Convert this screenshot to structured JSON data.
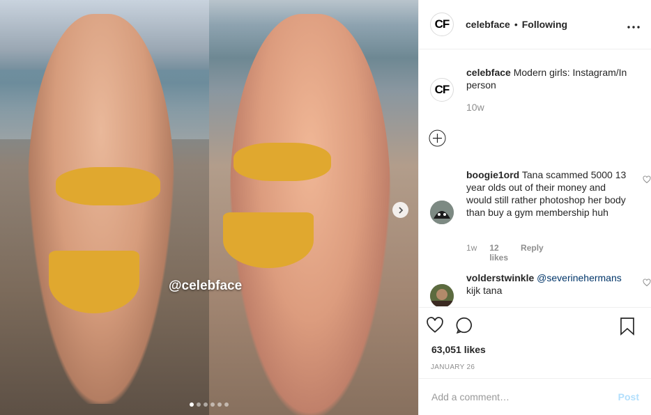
{
  "post": {
    "watermark": "@celebface",
    "slide_count": 6,
    "active_slide": 1
  },
  "header": {
    "avatar_text": "CF",
    "username": "celebface",
    "separator": "•",
    "follow_status": "Following",
    "more_icon": "more-dots-icon"
  },
  "caption": {
    "avatar_text": "CF",
    "username": "celebface",
    "text": "Modern girls: Instagram/In person",
    "time": "10w"
  },
  "comments": [
    {
      "username": "boogie1ord",
      "text": "Tana scammed 5000 13 year olds out of their money and would still rather photoshop her body than buy a gym membership huh",
      "time": "1w",
      "likes": "12 likes",
      "reply": "Reply"
    },
    {
      "username": "volderstwinkle",
      "mention": "@severinehermans",
      "text": "kijk tana"
    }
  ],
  "actions": {
    "likes": "63,051 likes",
    "date": "JANUARY 26"
  },
  "add_comment": {
    "placeholder": "Add a comment…",
    "post_label": "Post"
  },
  "colors": {
    "link_blue": "#003569",
    "post_disabled": "#b2dffc",
    "muted": "#8e8e8e"
  }
}
